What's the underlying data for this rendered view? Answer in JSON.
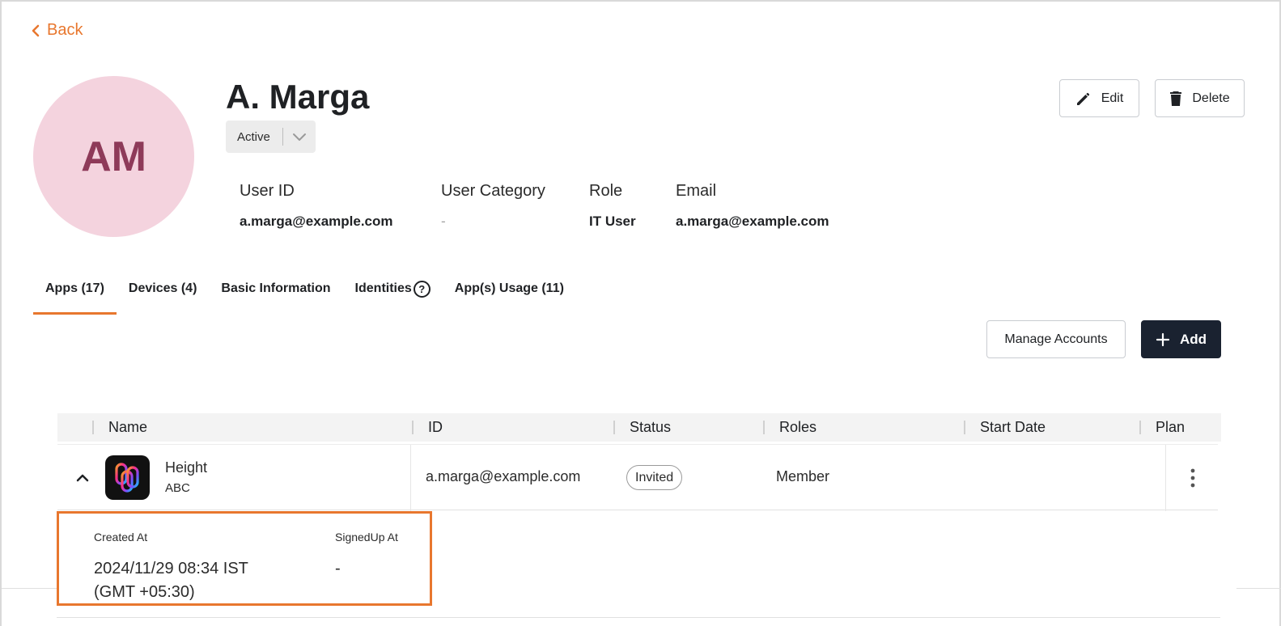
{
  "nav": {
    "back_label": "Back"
  },
  "user": {
    "initials": "AM",
    "name": "A. Marga",
    "status": "Active"
  },
  "actions": {
    "edit_label": "Edit",
    "delete_label": "Delete",
    "manage_accounts_label": "Manage Accounts",
    "add_label": "Add"
  },
  "info": [
    {
      "label": "User ID",
      "value": "a.marga@example.com"
    },
    {
      "label": "User Category",
      "value": "-"
    },
    {
      "label": "Role",
      "value": "IT User"
    },
    {
      "label": "Email",
      "value": "a.marga@example.com"
    }
  ],
  "tabs": [
    {
      "label": "Apps (17)"
    },
    {
      "label": "Devices (4)"
    },
    {
      "label": "Basic Information"
    },
    {
      "label": "Identities"
    },
    {
      "label": "App(s) Usage (11)"
    }
  ],
  "table": {
    "columns": [
      "Name",
      "ID",
      "Status",
      "Roles",
      "Start Date",
      "Plan"
    ],
    "rows": [
      {
        "app_name": "Height",
        "app_sub": "ABC",
        "id": "a.marga@example.com",
        "status": "Invited",
        "roles": "Member",
        "start_date": "",
        "plan": "",
        "details": {
          "created_at_label": "Created At",
          "created_at_value": "2024/11/29 08:34 IST (GMT +05:30)",
          "signed_up_label": "SignedUp At",
          "signed_up_value": "-"
        }
      }
    ]
  },
  "colors": {
    "accent": "#e8772e",
    "avatar_bg": "#f4d3de",
    "avatar_text": "#8e3a59",
    "primary_button": "#1a2230"
  }
}
